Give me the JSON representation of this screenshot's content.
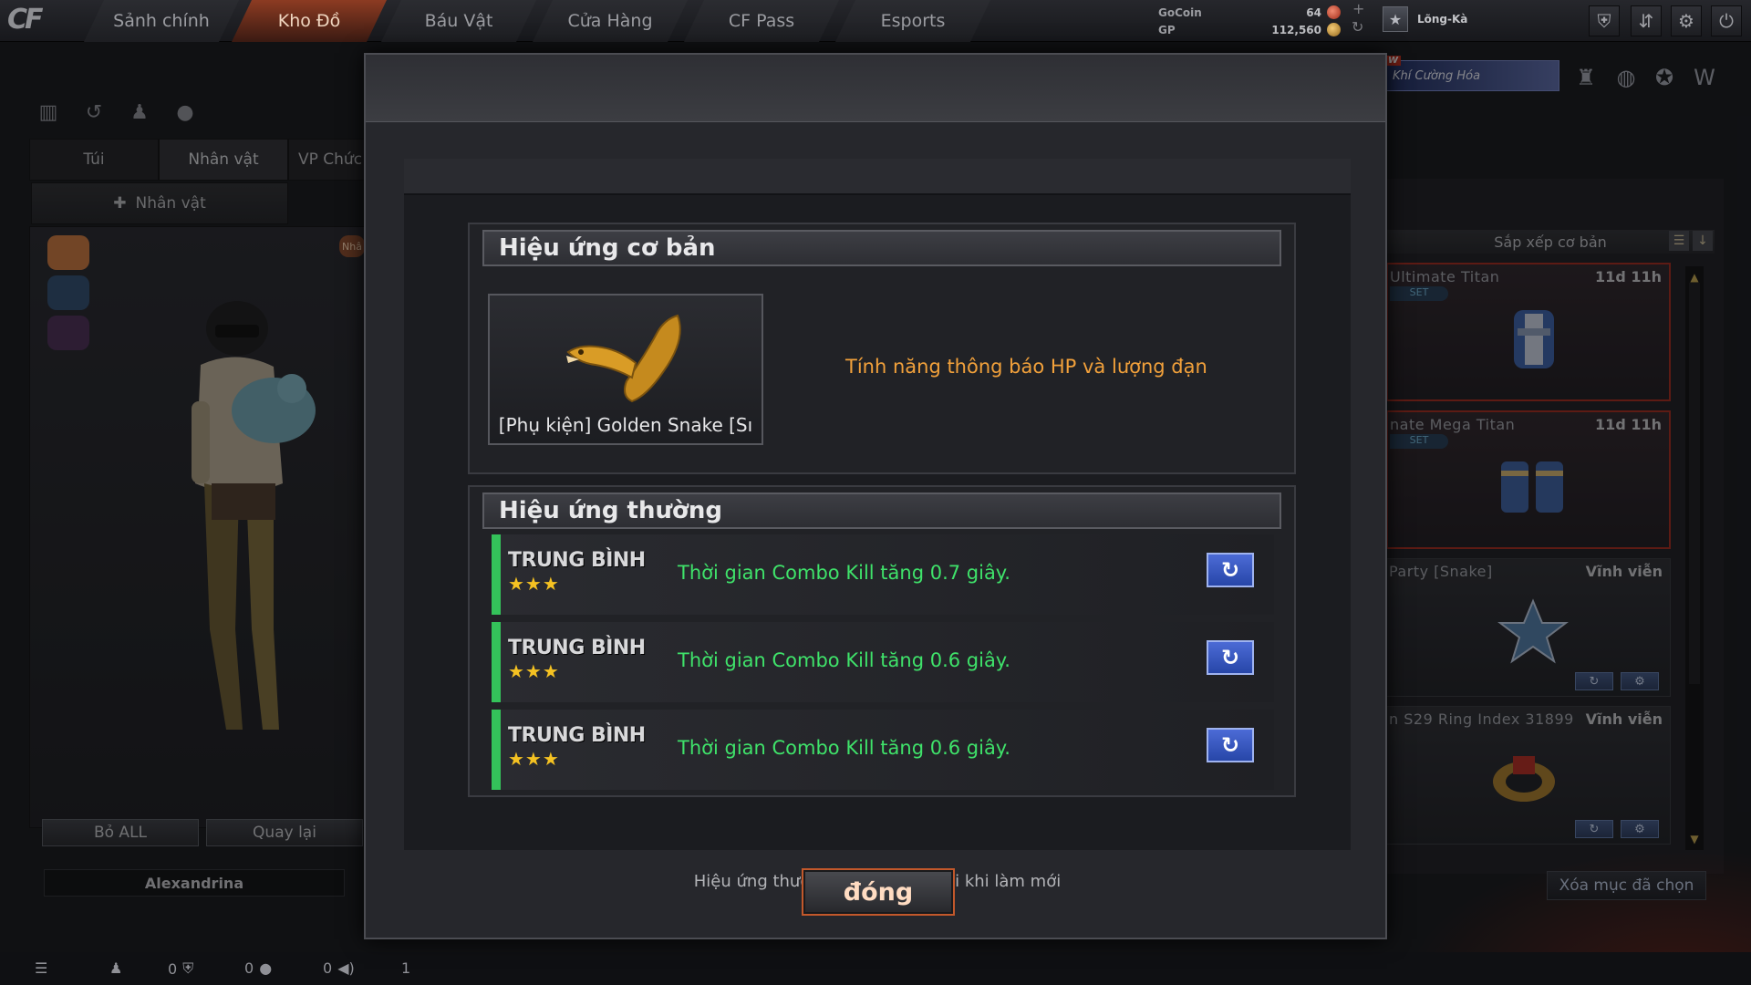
{
  "topbar": {
    "logo": "CF",
    "nav": [
      "Sảnh chính",
      "Kho Đồ",
      "Báu Vật",
      "Cửa Hàng",
      "CF Pass",
      "Esports"
    ],
    "active_nav": "Kho Đồ",
    "currency": {
      "gocoin_label": "GoCoin",
      "gocoin_value": "64",
      "gp_label": "GP",
      "gp_value": "112,560"
    },
    "player_name": "Lo͂ng-Kà"
  },
  "left": {
    "tabs": [
      "Túi",
      "Nhân vật",
      "VP Chức"
    ],
    "subtab": "Nhân vật",
    "buttons": {
      "drop_all": "Bỏ ALL",
      "back": "Quay lại"
    },
    "character_name": "Alexandrina",
    "side_tag": "Nhâ"
  },
  "right": {
    "event_badge": "W",
    "event_text": "Khí Cường Hóa",
    "sort_label": "Sắp xếp cơ bản",
    "items": [
      {
        "name": "Ultimate Titan",
        "time": "11d 11h",
        "tag": "SET"
      },
      {
        "name": "nate Mega Titan",
        "time": "11d 11h",
        "tag": "SET"
      },
      {
        "name": "Party [Snake]",
        "time": "Vĩnh viễn",
        "tag": ""
      },
      {
        "name": "n S29 Ring Index 31899",
        "time": "Vĩnh viễn",
        "tag": ""
      }
    ],
    "clear_label": "Xóa mục đã chọn"
  },
  "bottombar": {
    "counts": [
      "0",
      "0",
      "0",
      "1"
    ]
  },
  "modal": {
    "basic_section_title": "Hiệu ứng cơ bản",
    "item_name": "[Phụ kiện] Golden Snake [Sı",
    "basic_effect": "Tính năng thông báo HP và lượng đạn",
    "bonus_section_title": "Hiệu ứng thường",
    "effects": [
      {
        "grade": "TRUNG BÌNH",
        "rating": 3,
        "stars": "★★★",
        "text": "Thời gian Combo Kill tăng 0.7 giây."
      },
      {
        "grade": "TRUNG BÌNH",
        "rating": 3,
        "stars": "★★★",
        "text": "Thời gian Combo Kill tăng 0.6 giây."
      },
      {
        "grade": "TRUNG BÌNH",
        "rating": 3,
        "stars": "★★★",
        "text": "Thời gian Combo Kill tăng 0.6 giây."
      }
    ],
    "note": "Hiệu ứng thường có thể thay đổi khi làm mới",
    "close_label": "đóng"
  },
  "colors": {
    "accent": "#c2582b",
    "effect_green": "#3fe26a",
    "basic_orange": "#f2a13b",
    "star_gold": "#f5c222",
    "refresh_blue": "#2746a8"
  },
  "icons": {
    "refresh": "refresh-icon",
    "settings": "gear-icon",
    "power": "power-icon",
    "shield": "shield-icon"
  }
}
